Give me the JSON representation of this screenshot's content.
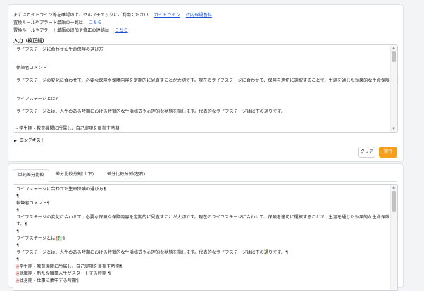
{
  "guide": {
    "line1_text": "まずはガイドライン等を確認の上、セルフチェックにご利用ください",
    "line1_link1": "ガイドライン",
    "line1_link2": "社内琢規基料",
    "line2_text": "置換ルールやアラート単語の一覧は",
    "line2_link": "こちら",
    "line3_text": "置換ルールやアラート単語の追加や修正の連絡は",
    "line3_link": "こちら"
  },
  "input": {
    "label": "入力（校正前）",
    "lines": [
      "ライフステージに合わせた生命保険の選び方",
      "",
      "執筆者コメント",
      "",
      "ライフステージの変化に合わせて、必要な保険や保障内容を定期的に見直すことが大切です。現在のライフステージに合わせて、保険を適切に選択することで、生涯を通じた効果的な生命保険を実現できます。",
      "",
      "ライフステージとは?",
      "",
      "ライフステージとは、人生のある時期における特徴的な生活様式や心理的な状態を指します。代表的なライフステージは以下の通りです。",
      "",
      "- 学生期 - 教育機関に所属し、自己実現を目指す時期"
    ]
  },
  "context": {
    "label": "コンテキスト"
  },
  "buttons": {
    "clear": "クリア",
    "run": "実行"
  },
  "tabs": [
    "単純差分比較",
    "差分比較分割(上下)",
    "差分比較分割(左右)"
  ],
  "output": {
    "line1": "ライフステージに合わせた生命保険の選び方¶",
    "para": "¶",
    "line3": "執筆者コメント¶",
    "line5": "ライフステージの変化に合わせて、必要な保険や保障内容を定期的に見直すことが大切です。現在のライフステージに合わせて、保険を適切に選択することで、生涯を通じた効果的な生命保険を実現できま",
    "line5b": "す。¶",
    "line7_a": "ライフステージとは",
    "line7_del": "?",
    "line7_add": "？",
    "line7_end": "¶",
    "line9_a": "ライフステージとは、人生のある時期における特徴的な生活様式や心理的な状態を指します。代表的なライフステージは以下の",
    "line9_hl": "通",
    "line9_b": "りです。¶",
    "item1": "学生期 - 教育機関に所属し、自己実現を目指す時期¶",
    "item2": "就職期 - 新たな職業人生がスタートする時期 ¶",
    "item3": "独身期 - 仕事に集中する時期¶",
    "item_prefix": "--"
  },
  "colors": {
    "run_button": "#f59f1b",
    "link": "#1a4fd8"
  }
}
